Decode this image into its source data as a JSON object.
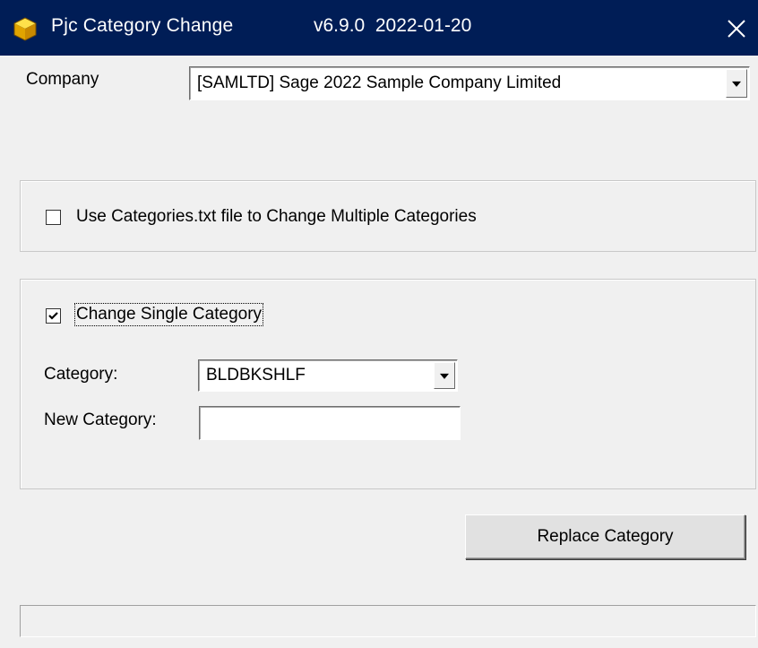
{
  "window": {
    "title": "Pjc Category Change",
    "version": "v6.9.0  2022-01-20",
    "icon": "yellow-cube-icon",
    "close_icon": "close-icon"
  },
  "company": {
    "label": "Company",
    "selected": "[SAMLTD] Sage 2022 Sample Company Limited"
  },
  "multi": {
    "checkbox_label": "Use Categories.txt file to Change Multiple Categories",
    "checked": false
  },
  "single": {
    "checkbox_label": "Change Single Category",
    "checked": true,
    "category_label": "Category:",
    "category_selected": "BLDBKSHLF",
    "new_category_label": "New Category:",
    "new_category_value": ""
  },
  "actions": {
    "replace_label": "Replace Category"
  },
  "status": {
    "text": ""
  },
  "colors": {
    "titlebar": "#001d56",
    "window_bg": "#f0f0f0"
  }
}
